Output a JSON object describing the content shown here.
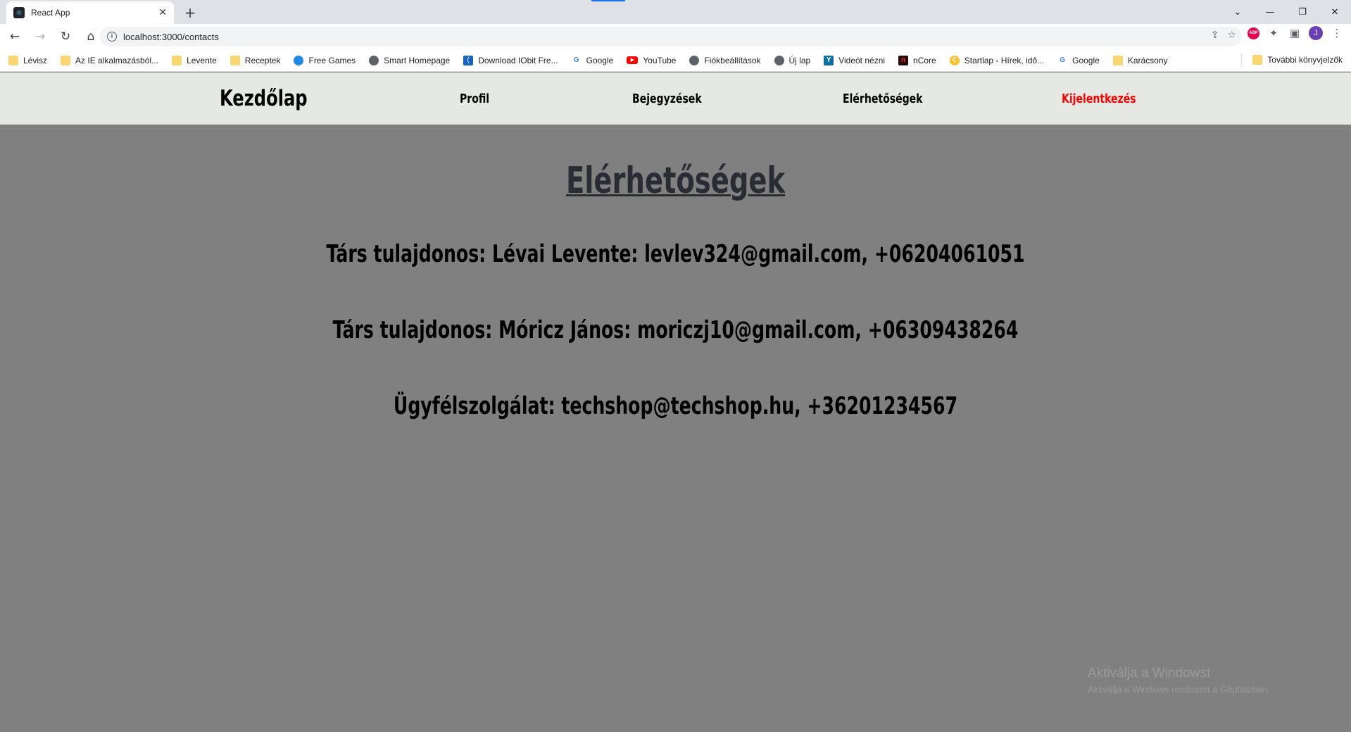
{
  "browser": {
    "tab": {
      "title": "React App",
      "close": "✕",
      "favicon": "react-icon"
    },
    "new_tab": "+",
    "window_controls": {
      "tabsearch": "⌄",
      "minimize": "—",
      "restore": "❐",
      "close": "✕"
    },
    "nav": {
      "back": "←",
      "forward": "→",
      "reload": "↻",
      "home": "⌂"
    },
    "url_info": "i",
    "url": "localhost:3000/contacts",
    "omnibox_icons": {
      "share": "⇪",
      "star": "☆"
    },
    "extensions": {
      "abp": "ABP",
      "puzzle": "✦",
      "sidepanel": "▣",
      "avatar": "J",
      "menu": "⋮"
    },
    "bookmarks": [
      {
        "label": "Lévisz",
        "icon": "folder"
      },
      {
        "label": "Az IE alkalmazásból...",
        "icon": "folder"
      },
      {
        "label": "Levente",
        "icon": "folder"
      },
      {
        "label": "Receptek",
        "icon": "folder"
      },
      {
        "label": "Free Games",
        "icon": "globe"
      },
      {
        "label": "Smart Homepage",
        "icon": "globe"
      },
      {
        "label": "Download IObit Fre...",
        "icon": "iobit"
      },
      {
        "label": "Google",
        "icon": "google"
      },
      {
        "label": "YouTube",
        "icon": "youtube"
      },
      {
        "label": "Fiókbeállítások",
        "icon": "globe"
      },
      {
        "label": "Új lap",
        "icon": "globe"
      },
      {
        "label": "Videót nézni",
        "icon": "y"
      },
      {
        "label": "nCore",
        "icon": "ncore"
      },
      {
        "label": "Startlap - Hírek, idő...",
        "icon": "startlap"
      },
      {
        "label": "Google",
        "icon": "google"
      },
      {
        "label": "Karácsony",
        "icon": "folder"
      }
    ],
    "other_bookmarks": "További könyvjelzők"
  },
  "site_nav": {
    "home": "Kezdőlap",
    "profile": "Profil",
    "posts": "Bejegyzések",
    "contacts": "Elérhetőségek",
    "logout": "Kijelentkezés",
    "logout_color": "#ff0000"
  },
  "main": {
    "heading": "Elérhetőségek",
    "contacts": [
      "Társ tulajdonos: Lévai Levente: levlev324@gmail.com, +06204061051",
      "Társ tulajdonos: Móricz János: moriczj10@gmail.com, +06309438264",
      "Ügyfélszolgálat: techshop@techshop.hu, +36201234567"
    ]
  },
  "watermark": {
    "title": "Aktiválja a Windowst",
    "subtitle": "Aktiválja a Windows rendszert a Gépházban."
  },
  "colors": {
    "page_background": "#808080",
    "nav_background": "#e6e8e3",
    "heading": "#2a2c33"
  }
}
